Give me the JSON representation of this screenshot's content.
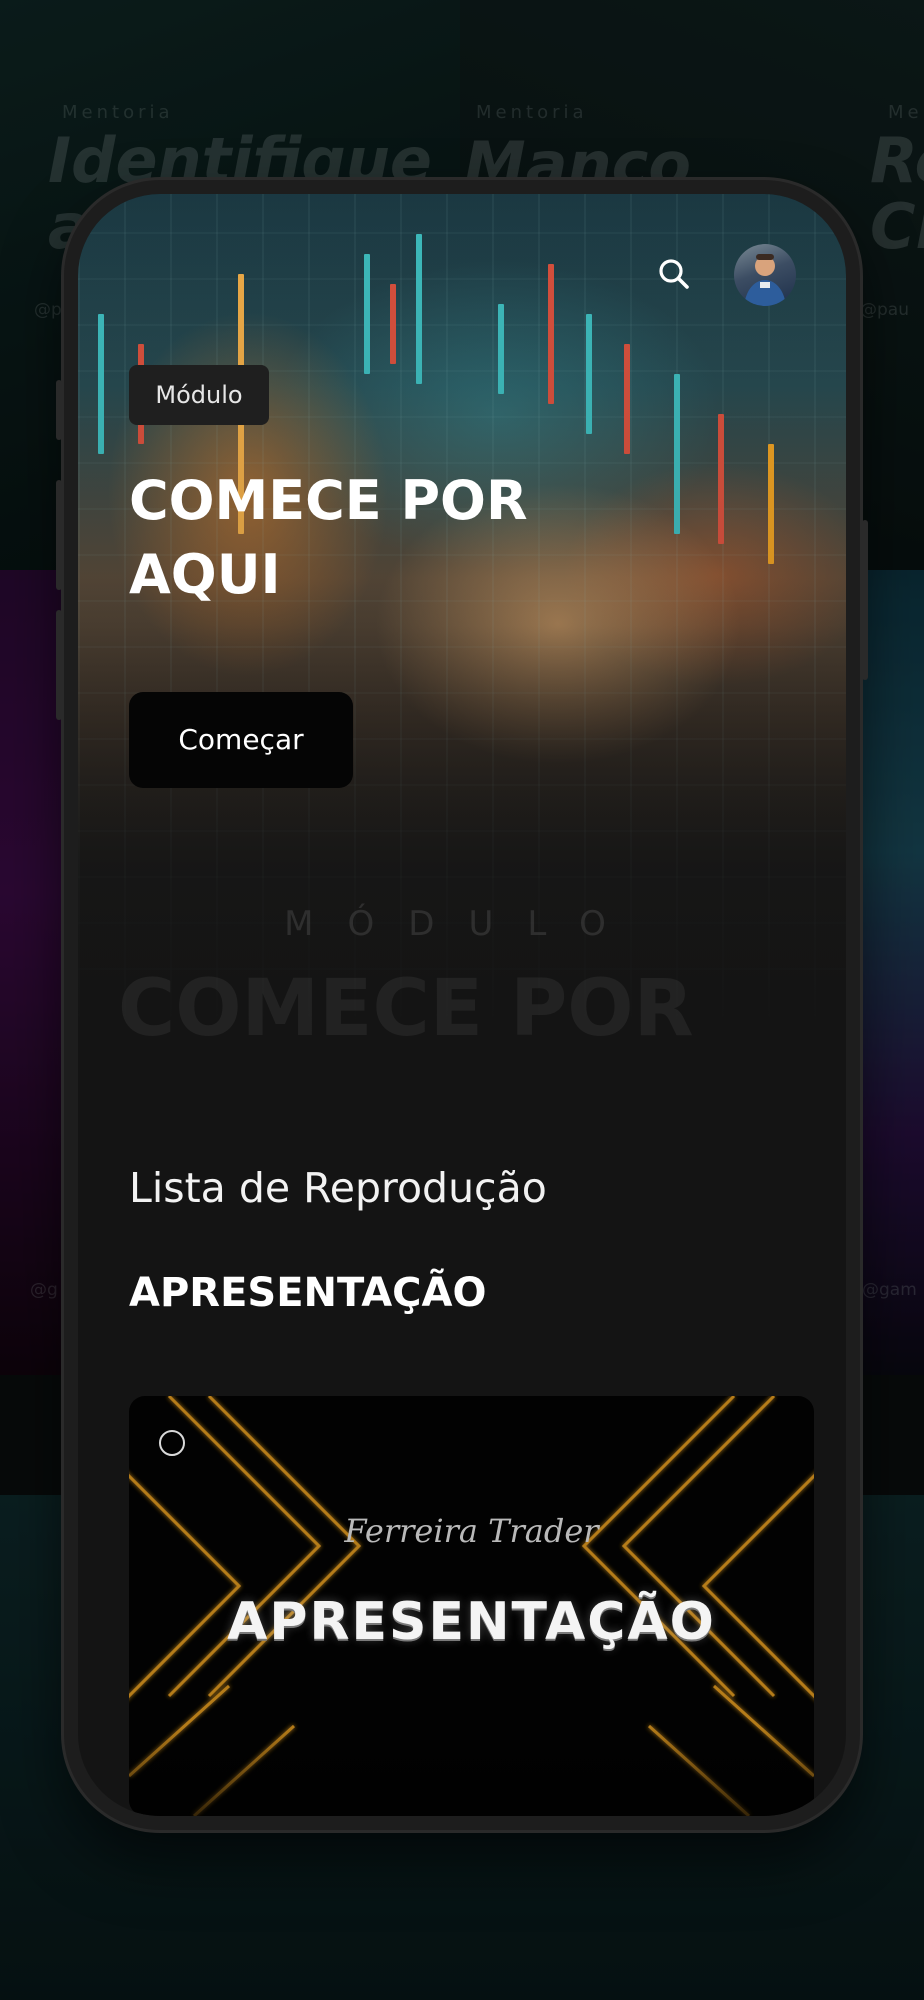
{
  "background": {
    "posters": [
      {
        "eyebrow": "Mentoria",
        "title": "Identifique a",
        "handle": "@p"
      },
      {
        "eyebrow": "Mentoria",
        "title": "Manço",
        "handle": ""
      },
      {
        "eyebrow": "Mentoria",
        "title": "Re Cr",
        "handle": "@pau"
      }
    ],
    "side_handles": {
      "left": "@g",
      "right": "@gam"
    }
  },
  "header": {
    "search_icon": "search-icon",
    "avatar_icon": "avatar"
  },
  "hero": {
    "tag": "Módulo",
    "title": "COMECE POR AQUI",
    "cta_label": "Começar",
    "ghost_tag": "MÓDULO",
    "ghost_title": "COMECE POR"
  },
  "playlist": {
    "heading": "Lista de Reprodução",
    "section_title": "APRESENTAÇÃO",
    "card": {
      "script_text": "Ferreira Trader",
      "title": "APRESENTAÇÃO"
    }
  },
  "colors": {
    "screen_bg": "#141414",
    "accent_orange": "#c98a1e",
    "button_bg": "#050505",
    "tag_bg": "#1f1f1f"
  }
}
